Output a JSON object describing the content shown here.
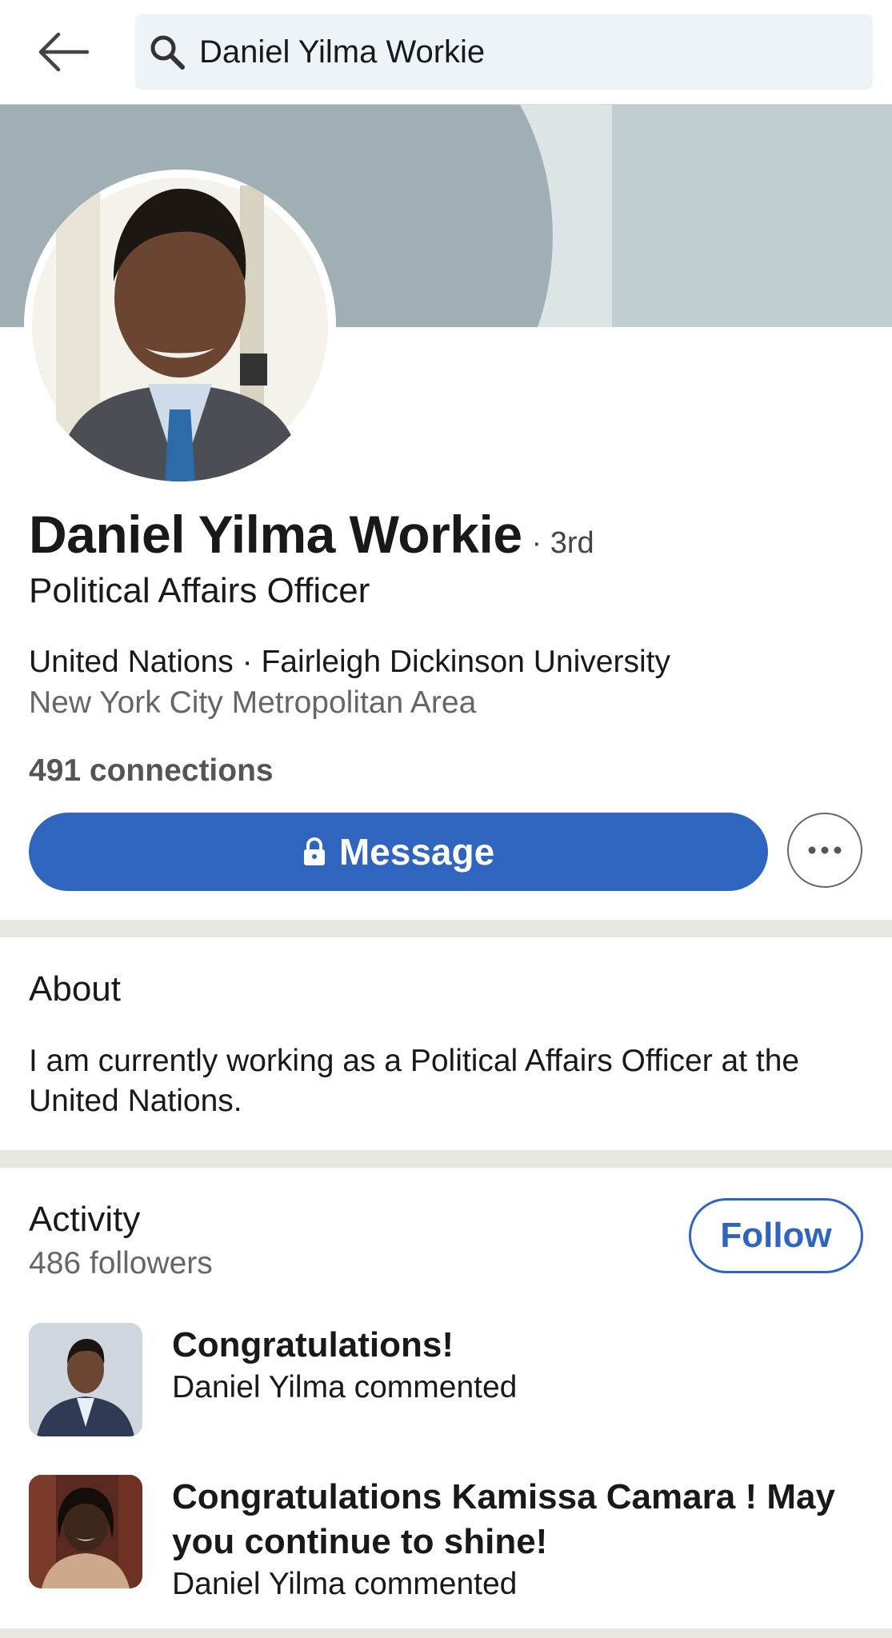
{
  "search": {
    "query": "Daniel Yilma Workie"
  },
  "profile": {
    "name": "Daniel Yilma Workie",
    "degree": "· 3rd",
    "headline": "Political Affairs Officer",
    "orgs": "United Nations · Fairleigh Dickinson University",
    "location": "New York City Metropolitan Area",
    "connections": "491 connections"
  },
  "actions": {
    "message_label": "Message"
  },
  "about": {
    "title": "About",
    "text": "I am currently working as a Political Affairs Officer at the United Nations."
  },
  "activity": {
    "title": "Activity",
    "followers": "486 followers",
    "follow_label": "Follow",
    "posts": [
      {
        "title": "Congratulations!",
        "meta": "Daniel Yilma commented"
      },
      {
        "title": "Congratulations Kamissa Camara ! May you continue to shine!",
        "meta": "Daniel Yilma commented"
      }
    ]
  },
  "colors": {
    "accent": "#2f64bf",
    "banner": "#a0afb4",
    "divider": "#e8e6e1"
  }
}
